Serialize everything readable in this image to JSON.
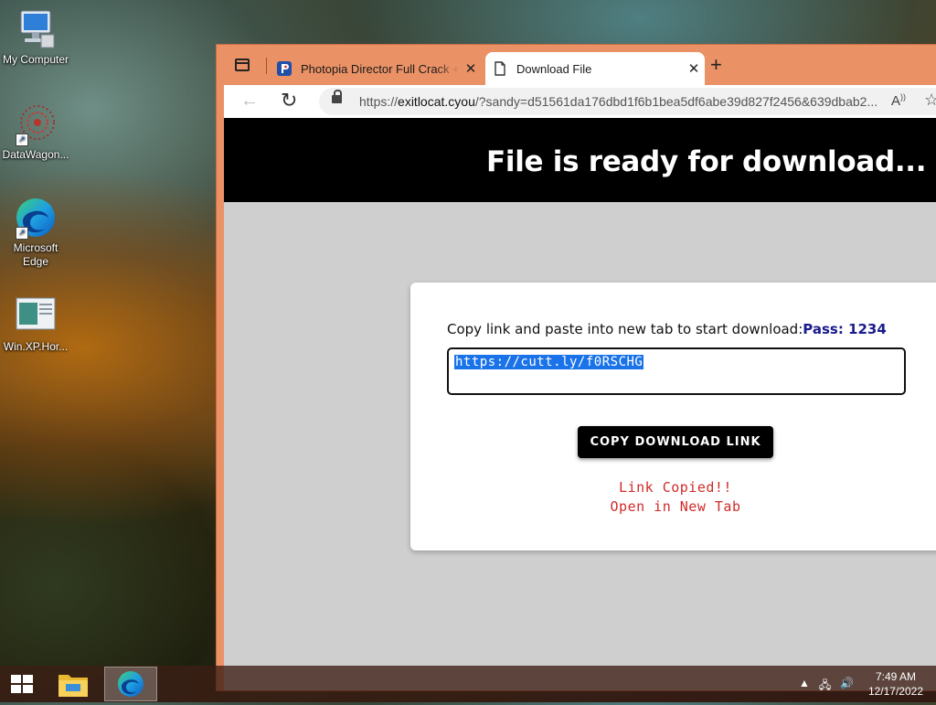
{
  "desktop": {
    "icons": [
      {
        "label": "My Computer"
      },
      {
        "label": "DataWagon..."
      },
      {
        "label": "Microsoft Edge"
      },
      {
        "label": "Win.XP.Hor..."
      }
    ]
  },
  "browser": {
    "tabs": [
      {
        "title": "Photopia Director Full Crack + Se",
        "icon": "photopia-favicon"
      },
      {
        "title": "Download File",
        "icon": "document-icon",
        "active": true
      }
    ],
    "new_tab_label": "+",
    "address_bar": {
      "prefix": "https://",
      "host": "exitlocat.cyou",
      "path": "/?sandy=d51561da176dbd1f6b1bea5df6abe39d827f2456&639dbab2..."
    }
  },
  "page": {
    "banner_title": "File is ready for download...",
    "instruction": "Copy link and paste into new tab to start download:",
    "pass_label": "Pass: 1234",
    "link_value": "https://cutt.ly/f0RSCHG",
    "copy_button": "COPY DOWNLOAD LINK",
    "copied_msg": "Link Copied!!",
    "open_msg": "Open in New Tab",
    "colors": {
      "banner": "#000000",
      "pass": "#1a1a8c",
      "copied": "#d02a2a",
      "selection": "#1a73e8"
    }
  },
  "taskbar": {
    "time": "7:49 AM",
    "date": "12/17/2022"
  }
}
